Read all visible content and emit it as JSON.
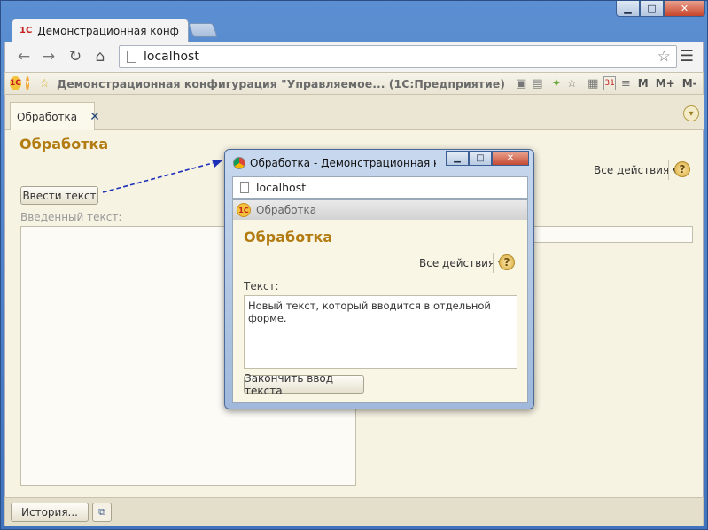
{
  "browser": {
    "tab_title": "Демонстрационная конф",
    "address": "localhost",
    "window_controls": {
      "minimize": "▁",
      "maximize": "□",
      "close": "✕"
    }
  },
  "toolbar1c": {
    "title": "Демонстрационная конфигурация \"Управляемое... (1С:Предприятие)",
    "m": "M",
    "m_plus": "M+",
    "m_minus": "M-",
    "calendar_day": "31"
  },
  "form": {
    "tab_label": "Обработка",
    "heading": "Обработка",
    "all_actions": "Все действия ▾",
    "enter_text_button": "Ввести текст",
    "entered_text_label": "Введенный текст:",
    "help": "?"
  },
  "bottom": {
    "history_button": "История..."
  },
  "popup": {
    "title": "Обработка - Демонстрационная ко",
    "address": "localhost",
    "header": "Обработка",
    "heading": "Обработка",
    "all_actions": "Все действия ▾",
    "help": "?",
    "text_label": "Текст:",
    "text_value": "Новый текст, который вводится в отдельной форме.",
    "finish_button": "Закончить ввод текста"
  },
  "colors": {
    "heading": "#b27c12",
    "form_bg": "#f7f3e3",
    "arrow": "#1c2fb8"
  },
  "icons": {
    "back": "arrow-left-icon",
    "forward": "arrow-right-icon",
    "reload": "reload-icon",
    "home": "home-icon",
    "bookmark": "star-icon",
    "menu": "hamburger-icon"
  }
}
